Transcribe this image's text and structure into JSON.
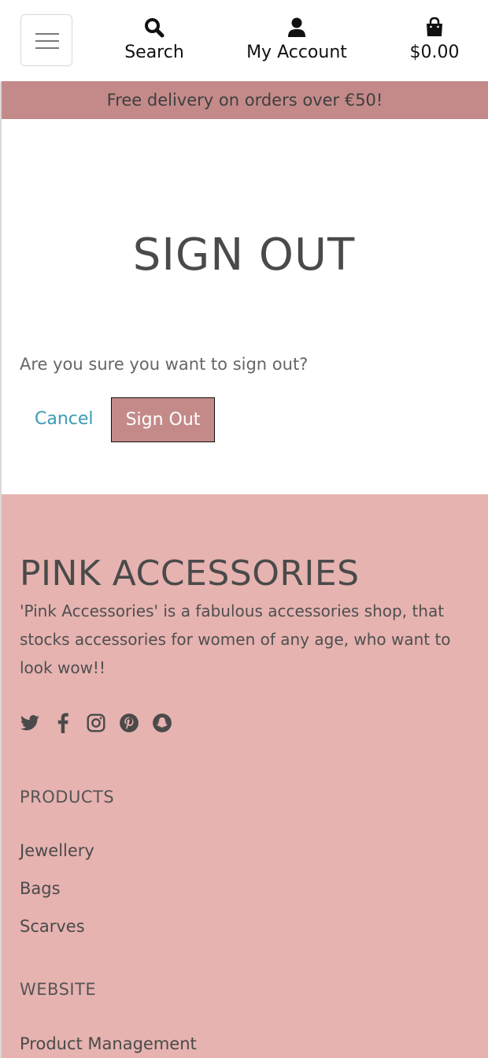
{
  "header": {
    "nav": [
      {
        "label": "Search",
        "icon": "search-icon"
      },
      {
        "label": "My Account",
        "icon": "user-icon"
      },
      {
        "label": "$0.00",
        "icon": "shopping-bag-icon"
      }
    ]
  },
  "banner": {
    "text": "Free delivery on orders over €50!"
  },
  "main": {
    "title": "SIGN OUT",
    "question": "Are you sure you want to sign out?",
    "cancel_label": "Cancel",
    "signout_label": "Sign Out"
  },
  "footer": {
    "brand": "PINK ACCESSORIES",
    "tagline": "'Pink Accessories' is a fabulous accessories shop, that stocks accessories for women of any age, who want to look wow!!",
    "socials": [
      "twitter-icon",
      "facebook-icon",
      "instagram-icon",
      "pinterest-icon",
      "snapchat-icon"
    ],
    "products_heading": "PRODUCTS",
    "products": [
      "Jewellery",
      "Bags",
      "Scarves"
    ],
    "website_heading": "WEBSITE",
    "website_links": [
      "Product Management"
    ]
  },
  "colors": {
    "accent": "#c48a8a",
    "footer_bg": "#e6b3b1",
    "link": "#3a9bb5",
    "text": "#4d4d4d"
  }
}
